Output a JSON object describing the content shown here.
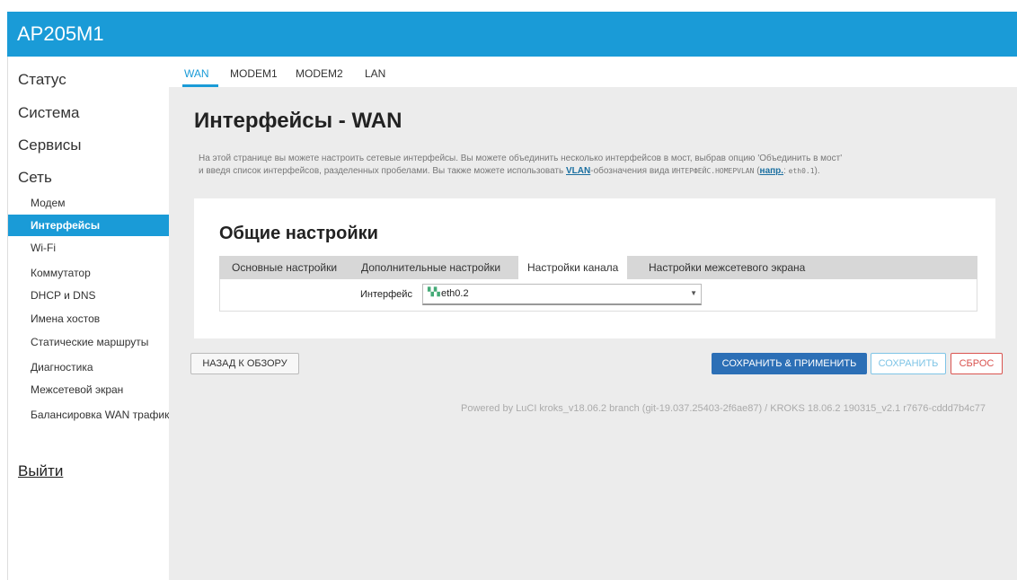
{
  "header": {
    "title": "AP205M1",
    "accent_color": "#1a9bd7"
  },
  "sidebar": {
    "top_items": [
      "Статус",
      "Система",
      "Сервисы",
      "Сеть"
    ],
    "sub_items": [
      {
        "label": "Модем"
      },
      {
        "label": "Интерфейсы",
        "active": true
      },
      {
        "label": "Wi-Fi"
      },
      {
        "label": "Коммутатор"
      },
      {
        "label": "DHCP и DNS"
      },
      {
        "label": "Имена хостов"
      },
      {
        "label": "Статические маршруты"
      },
      {
        "label": "Диагностика"
      },
      {
        "label": "Межсетевой экран"
      },
      {
        "label": "Балансировка WAN трафика"
      }
    ],
    "logout": "Выйти"
  },
  "tabs": [
    "WAN",
    "MODEM1",
    "MODEM2",
    "LAN"
  ],
  "active_tab": "WAN",
  "page": {
    "title": "Интерфейсы - WAN",
    "desc_line1": "На этой странице вы можете настроить сетевые интерфейсы. Вы можете объединить несколько интерфейсов в мост, выбрав опцию 'Объединить в мост'",
    "desc_line2_a": "и введя список интерфейсов, разделенных пробелами. Вы также можете использовать ",
    "desc_vlan": "VLAN",
    "desc_line2_b": "-обозначения вида ",
    "desc_mono1": "ИНТЕРФЕЙС.НОМЕРVLAN",
    "desc_line2_c": " (",
    "desc_example": "напр.",
    "desc_line2_d": ": ",
    "desc_mono2": "eth0.1",
    "desc_line2_e": ")."
  },
  "section": {
    "title": "Общие настройки",
    "subtabs": [
      "Основные настройки",
      "Дополнительные настройки",
      "Настройки канала",
      "Настройки межсетевого экрана"
    ],
    "active_subtab": "Настройки канала",
    "field_label": "Интерфейс",
    "field_value": "eth0.2",
    "field_icon": "network-port-icon"
  },
  "buttons": {
    "back": "НАЗАД К ОБЗОРУ",
    "save_apply": "СОХРАНИТЬ & ПРИМЕНИТЬ",
    "save": "СОХРАНИТЬ",
    "reset": "СБРОС"
  },
  "footer": "Powered by LuCI kroks_v18.06.2 branch (git-19.037.25403-2f6ae87) / KROKS 18.06.2 190315_v2.1 r7676-cddd7b4c77"
}
